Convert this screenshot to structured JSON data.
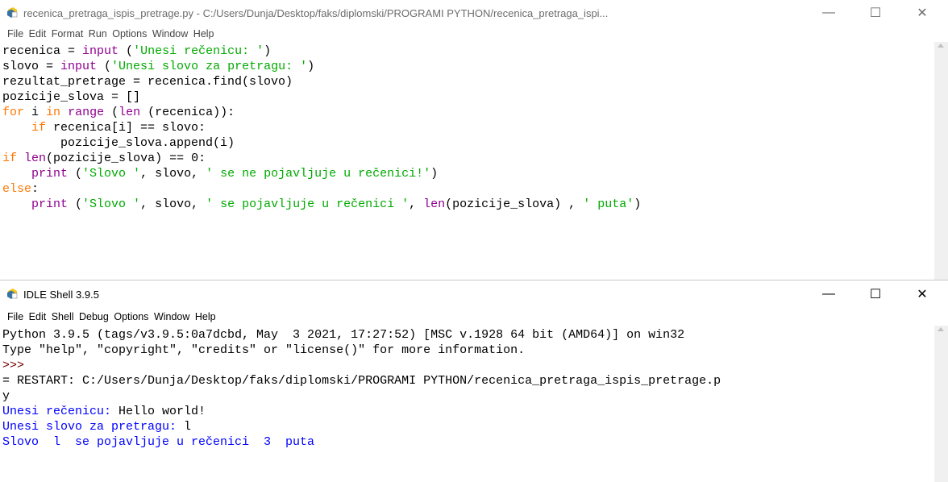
{
  "editor": {
    "title": "recenica_pretraga_ispis_pretrage.py - C:/Users/Dunja/Desktop/faks/diplomski/PROGRAMI PYTHON/recenica_pretraga_ispi...",
    "menu": [
      "File",
      "Edit",
      "Format",
      "Run",
      "Options",
      "Window",
      "Help"
    ],
    "window_controls": {
      "minimize": "—",
      "maximize": "☐",
      "close": "✕"
    },
    "code_lines": [
      [
        {
          "t": "recenica = "
        },
        {
          "t": "input",
          "c": "bi"
        },
        {
          "t": " ("
        },
        {
          "t": "'Unesi rečenicu: '",
          "c": "str"
        },
        {
          "t": ")"
        }
      ],
      [
        {
          "t": "slovo = "
        },
        {
          "t": "input",
          "c": "bi"
        },
        {
          "t": " ("
        },
        {
          "t": "'Unesi slovo za pretragu: '",
          "c": "str"
        },
        {
          "t": ")"
        }
      ],
      [
        {
          "t": "rezultat_pretrage = recenica.find(slovo)"
        }
      ],
      [
        {
          "t": "pozicije_slova = []"
        }
      ],
      [
        {
          "t": "for",
          "c": "kw"
        },
        {
          "t": " i "
        },
        {
          "t": "in",
          "c": "kw"
        },
        {
          "t": " "
        },
        {
          "t": "range",
          "c": "bi"
        },
        {
          "t": " ("
        },
        {
          "t": "len",
          "c": "bi"
        },
        {
          "t": " (recenica)):"
        }
      ],
      [
        {
          "t": "    "
        },
        {
          "t": "if",
          "c": "kw"
        },
        {
          "t": " recenica[i] == slovo:"
        }
      ],
      [
        {
          "t": "        pozicije_slova.append(i)"
        }
      ],
      [
        {
          "t": "if",
          "c": "kw"
        },
        {
          "t": " "
        },
        {
          "t": "len",
          "c": "bi"
        },
        {
          "t": "(pozicije_slova) == 0:"
        }
      ],
      [
        {
          "t": "    "
        },
        {
          "t": "print",
          "c": "bi"
        },
        {
          "t": " ("
        },
        {
          "t": "'Slovo '",
          "c": "str"
        },
        {
          "t": ", slovo, "
        },
        {
          "t": "' se ne pojavljuje u rečenici!'",
          "c": "str"
        },
        {
          "t": ")"
        }
      ],
      [
        {
          "t": "else",
          "c": "kw"
        },
        {
          "t": ":"
        }
      ],
      [
        {
          "t": "    "
        },
        {
          "t": "print",
          "c": "bi"
        },
        {
          "t": " ("
        },
        {
          "t": "'Slovo '",
          "c": "str"
        },
        {
          "t": ", slovo, "
        },
        {
          "t": "' se pojavljuje u rečenici '",
          "c": "str"
        },
        {
          "t": ", "
        },
        {
          "t": "len",
          "c": "bi"
        },
        {
          "t": "(pozicije_slova) , "
        },
        {
          "t": "' puta'",
          "c": "str"
        },
        {
          "t": ")"
        }
      ]
    ]
  },
  "shell": {
    "title": "IDLE Shell 3.9.5",
    "menu": [
      "File",
      "Edit",
      "Shell",
      "Debug",
      "Options",
      "Window",
      "Help"
    ],
    "window_controls": {
      "minimize": "—",
      "maximize": "☐",
      "close": "✕"
    },
    "lines": [
      [
        {
          "t": "Python 3.9.5 (tags/v3.9.5:0a7dcbd, May  3 2021, 17:27:52) [MSC v.1928 64 bit (AMD64)] on win32"
        }
      ],
      [
        {
          "t": "Type \"help\", \"copyright\", \"credits\" or \"license()\" for more information."
        }
      ],
      [
        {
          "t": ">>>",
          "c": "prompt"
        }
      ],
      [
        {
          "t": "= RESTART: C:/Users/Dunja/Desktop/faks/diplomski/PROGRAMI PYTHON/recenica_pretraga_ispis_pretrage.p"
        }
      ],
      [
        {
          "t": "y"
        }
      ],
      [
        {
          "t": "Unesi rečenicu: ",
          "c": "out"
        },
        {
          "t": "Hello world!"
        }
      ],
      [
        {
          "t": "Unesi slovo za pretragu: ",
          "c": "out"
        },
        {
          "t": "l"
        }
      ],
      [
        {
          "t": "Slovo  l  se pojavljuje u rečenici  3  puta",
          "c": "out"
        }
      ]
    ]
  },
  "colors": {
    "keyword": "#ff7700",
    "builtin": "#900090",
    "string": "#00aa00",
    "output": "#0000ff",
    "prompt": "#770000"
  },
  "icons": {
    "app": "python-idle-icon"
  }
}
